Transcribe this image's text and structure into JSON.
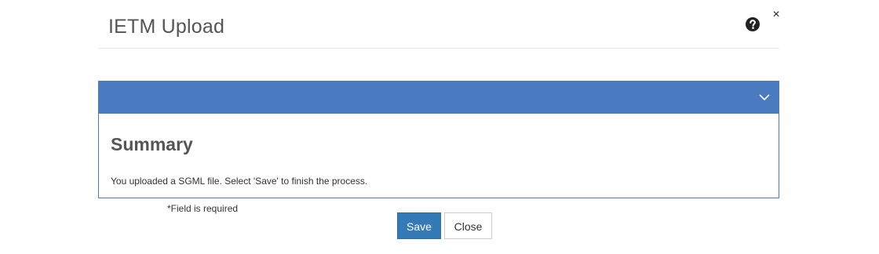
{
  "dialog": {
    "title": "IETM Upload",
    "help_icon": "question-circle-icon",
    "close_symbol": "×"
  },
  "panel": {
    "header_color": "#4a7abf",
    "toggle_icon": "chevron-down-icon",
    "heading": "Summary",
    "message": "You uploaded a SGML file. Select 'Save' to finish the process."
  },
  "footer": {
    "required_note": "*Field is required",
    "save_label": "Save",
    "close_label": "Close",
    "primary_color": "#337ab7"
  }
}
